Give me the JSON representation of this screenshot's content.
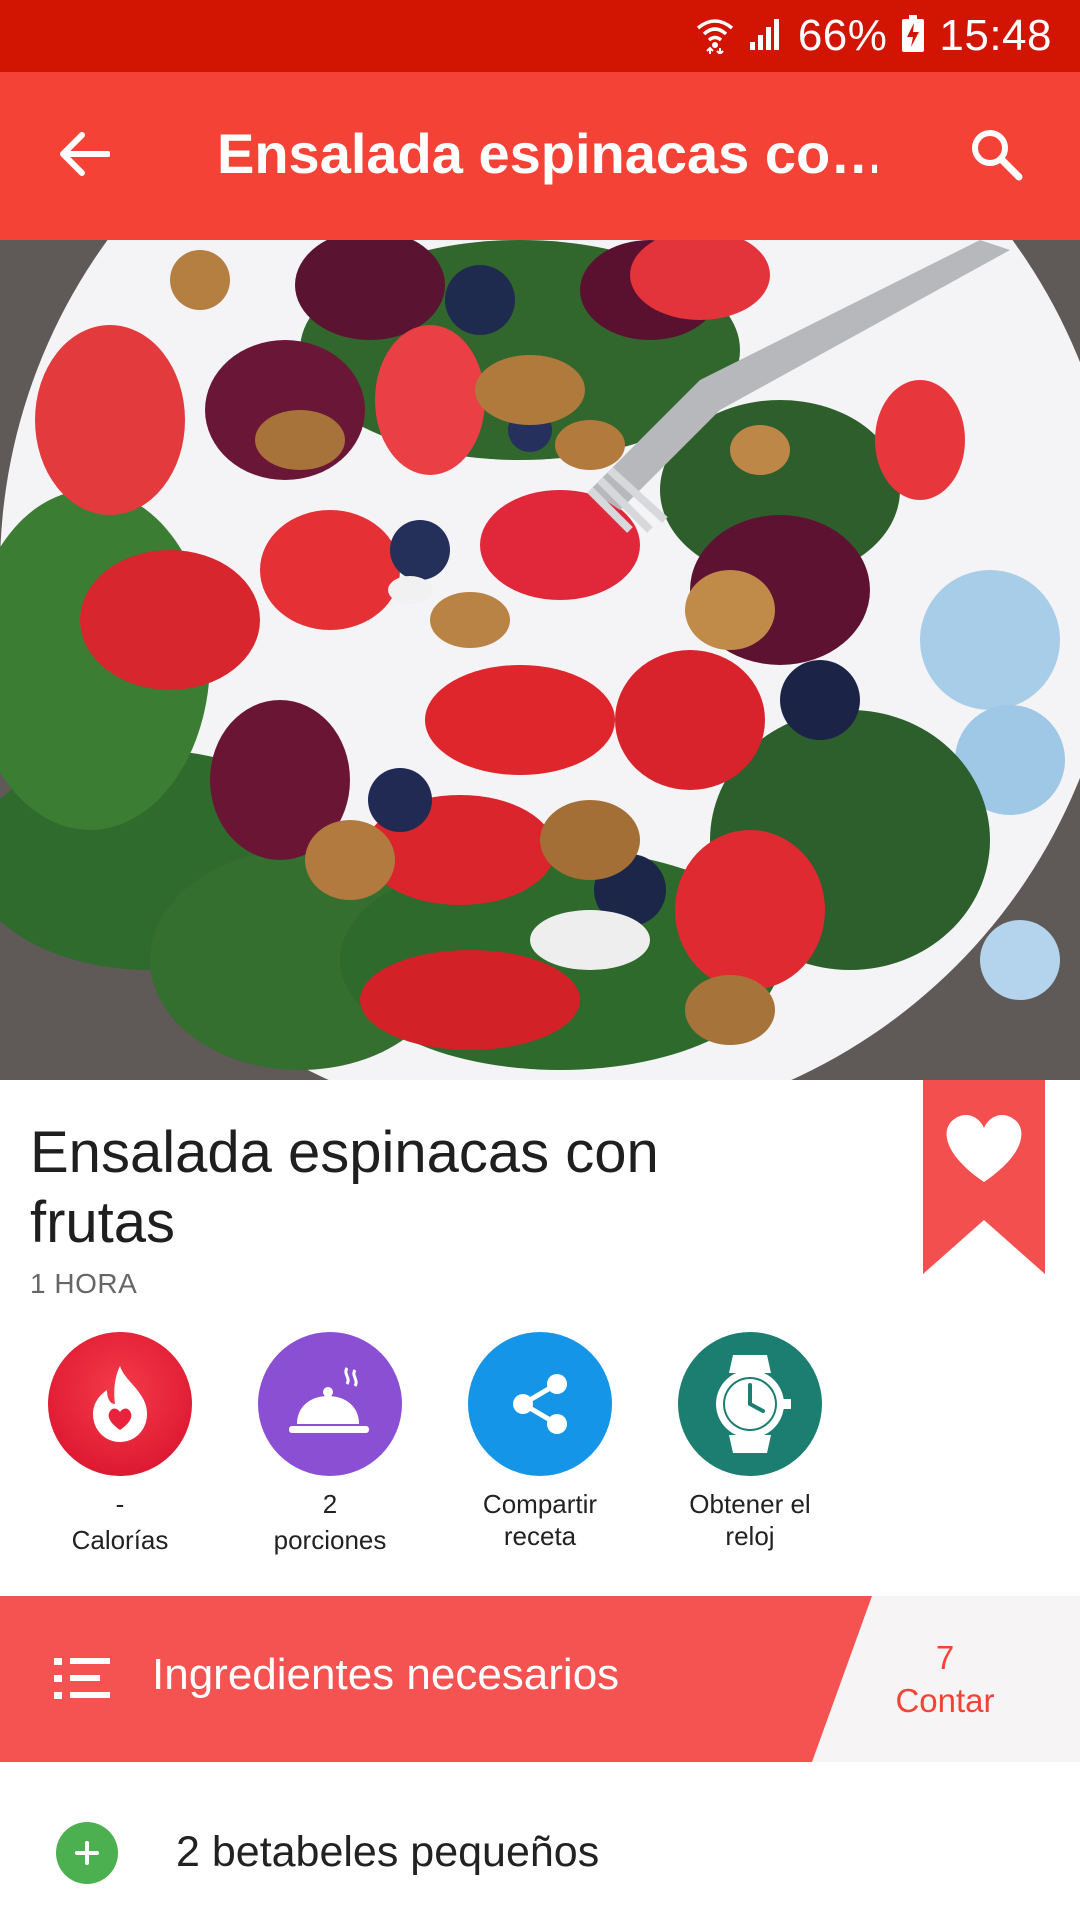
{
  "status_bar": {
    "battery": "66%",
    "time": "15:48",
    "icons": [
      "wifi-icon",
      "signal-icon",
      "battery-charging-icon"
    ]
  },
  "app_bar": {
    "title": "Ensalada espinacas co…",
    "back_icon": "arrow-back-icon",
    "search_icon": "search-icon"
  },
  "hero": {
    "icon": "salad-photo"
  },
  "recipe": {
    "title": "Ensalada espinacas con frutas",
    "time": "1 HORA",
    "favorite_icon": "heart-bookmark-icon"
  },
  "actions": [
    {
      "value": "-",
      "label": "Calorías",
      "icon": "calories-flame-icon",
      "color": "#e8233b"
    },
    {
      "value": "2",
      "label": "porciones",
      "icon": "cloche-icon",
      "color": "#8b4fd3"
    },
    {
      "value": "Compartir",
      "label": "receta",
      "icon": "share-icon",
      "color": "#1495e8"
    },
    {
      "value": "Obtener el",
      "label": "reloj",
      "icon": "watch-icon",
      "color": "#1c7e70"
    }
  ],
  "ingredients": {
    "title": "Ingredientes necesarios",
    "count": "7",
    "count_label": "Contar",
    "list_icon": "list-icon",
    "items": [
      {
        "text": "2 betabeles pequeños",
        "icon": "add-icon"
      }
    ]
  },
  "colors": {
    "status_bar": "#d21503",
    "primary": "#f44336",
    "add_green": "#4caf50"
  }
}
